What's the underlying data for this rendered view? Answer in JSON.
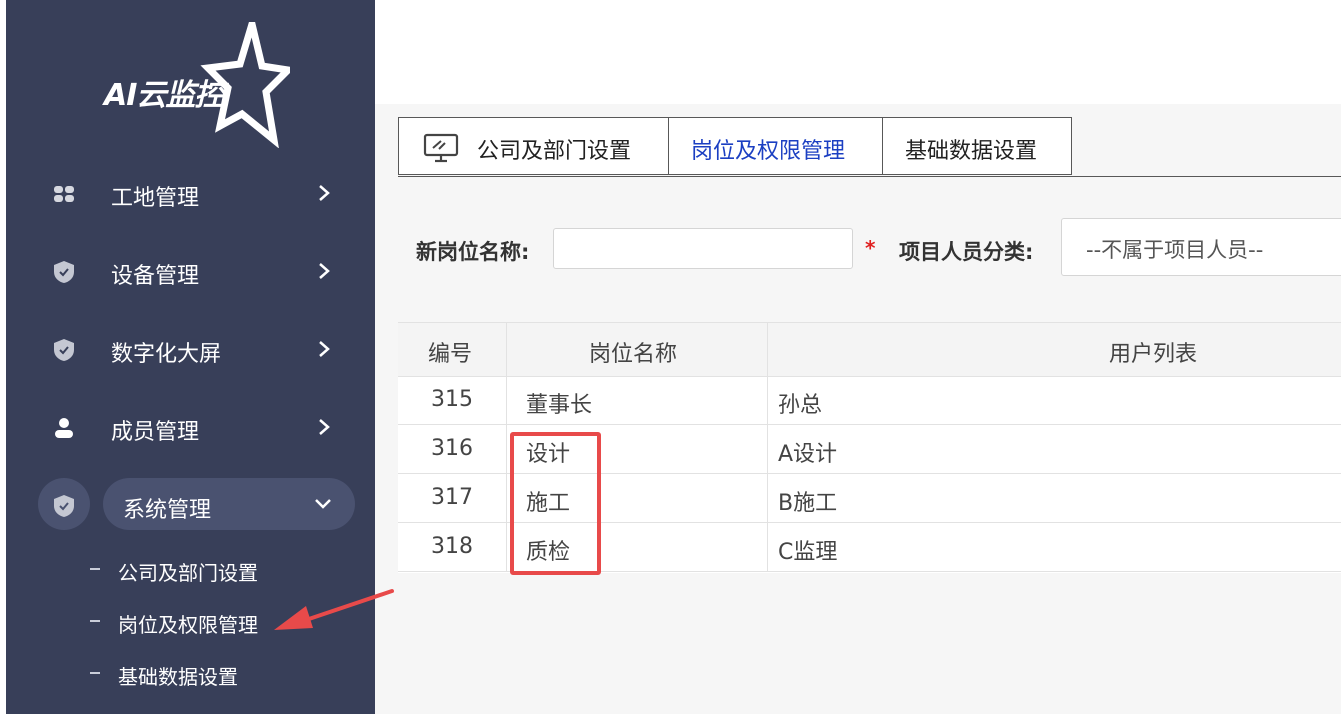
{
  "brand": {
    "name": "AI云监控"
  },
  "sidebar": {
    "items": [
      {
        "label": "工地管理",
        "icon": "grid-icon"
      },
      {
        "label": "设备管理",
        "icon": "shield-icon"
      },
      {
        "label": "数字化大屏",
        "icon": "shield-icon"
      },
      {
        "label": "成员管理",
        "icon": "user-icon"
      },
      {
        "label": "系统管理",
        "icon": "shield-icon",
        "expanded": true
      }
    ],
    "subitems": [
      {
        "label": "公司及部门设置"
      },
      {
        "label": "岗位及权限管理"
      },
      {
        "label": "基础数据设置"
      }
    ]
  },
  "tabs": [
    {
      "label": "公司及部门设置",
      "icon": "monitor-icon"
    },
    {
      "label": "岗位及权限管理",
      "active": true
    },
    {
      "label": "基础数据设置"
    }
  ],
  "form": {
    "new_position_label": "新岗位名称:",
    "new_position_value": "",
    "required_mark": "*",
    "category_label": "项目人员分类:",
    "category_selected": "--不属于项目人员--"
  },
  "table": {
    "headers": [
      "编号",
      "岗位名称",
      "用户列表"
    ],
    "rows": [
      [
        "315",
        "董事长",
        "孙总"
      ],
      [
        "316",
        "设计",
        "A设计"
      ],
      [
        "317",
        "施工",
        "B施工"
      ],
      [
        "318",
        "质检",
        "C监理"
      ]
    ]
  },
  "colors": {
    "sidebar_bg": "#383f59",
    "active_pill": "#4a5270",
    "active_tab_text": "#1b3fc2",
    "annotation_red": "#e84a4a"
  }
}
